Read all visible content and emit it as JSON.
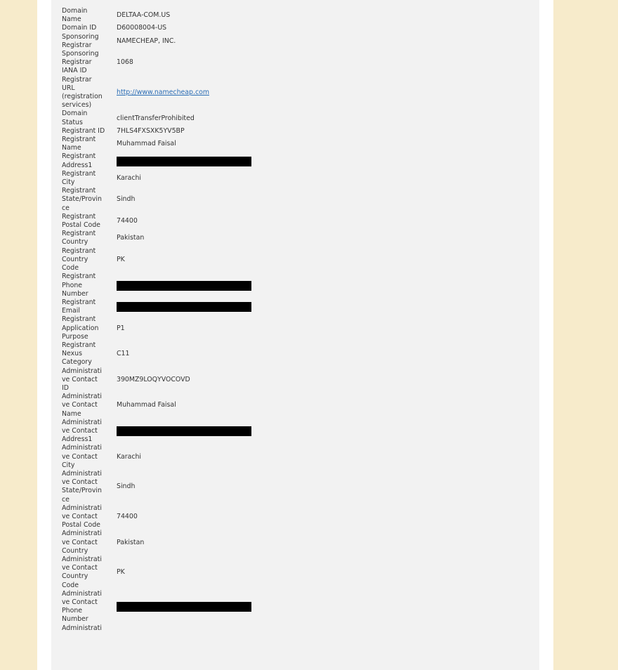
{
  "rows": [
    {
      "label": [
        "Domain",
        "Name"
      ],
      "value": "DELTAA-COM.US"
    },
    {
      "label": [
        "Domain ID"
      ],
      "value": "D60008004-US"
    },
    {
      "label": [
        "Sponsoring",
        "Registrar"
      ],
      "value": "NAMECHEAP, INC."
    },
    {
      "label": [
        "Sponsoring",
        "Registrar",
        "IANA ID"
      ],
      "value": "1068"
    },
    {
      "label": [
        "Registrar",
        "URL",
        "(registration",
        "services)"
      ],
      "value": "http://www.namecheap.com",
      "link": true
    },
    {
      "label": [
        "Domain",
        "Status"
      ],
      "value": "clientTransferProhibited"
    },
    {
      "label": [
        "Registrant ID"
      ],
      "value": "7HLS4FXSXK5YV5BP"
    },
    {
      "label": [
        "Registrant",
        "Name"
      ],
      "value": "Muhammad Faisal"
    },
    {
      "label": [
        "Registrant",
        "Address1"
      ],
      "value": "",
      "redacted": true
    },
    {
      "label": [
        "Registrant",
        "City"
      ],
      "value": "Karachi"
    },
    {
      "label": [
        "Registrant",
        "State/Provin",
        "ce"
      ],
      "value": "Sindh"
    },
    {
      "label": [
        "Registrant",
        "Postal Code"
      ],
      "value": "74400"
    },
    {
      "label": [
        "Registrant",
        "Country"
      ],
      "value": "Pakistan"
    },
    {
      "label": [
        "Registrant",
        "Country",
        "Code"
      ],
      "value": "PK"
    },
    {
      "label": [
        "Registrant",
        "Phone",
        "Number"
      ],
      "value": "",
      "redacted": true
    },
    {
      "label": [
        "Registrant",
        "Email"
      ],
      "value": "",
      "redacted": true
    },
    {
      "label": [
        "Registrant",
        "Application",
        "Purpose"
      ],
      "value": "P1"
    },
    {
      "label": [
        "Registrant",
        "Nexus",
        "Category"
      ],
      "value": "C11"
    },
    {
      "label": [
        "Administrati",
        "ve Contact",
        "ID"
      ],
      "value": "390MZ9LOQYVOCOVD"
    },
    {
      "label": [
        "Administrati",
        "ve Contact",
        "Name"
      ],
      "value": "Muhammad Faisal"
    },
    {
      "label": [
        "Administrati",
        "ve Contact",
        "Address1"
      ],
      "value": "",
      "redacted": true
    },
    {
      "label": [
        "Administrati",
        "ve Contact",
        "City"
      ],
      "value": "Karachi"
    },
    {
      "label": [
        "Administrati",
        "ve Contact",
        "State/Provin",
        "ce"
      ],
      "value": "Sindh"
    },
    {
      "label": [
        "Administrati",
        "ve Contact",
        "Postal Code"
      ],
      "value": "74400"
    },
    {
      "label": [
        "Administrati",
        "ve Contact",
        "Country"
      ],
      "value": "Pakistan"
    },
    {
      "label": [
        "Administrati",
        "ve Contact",
        "Country",
        "Code"
      ],
      "value": "PK"
    },
    {
      "label": [
        "Administrati",
        "ve Contact",
        "Phone",
        "Number"
      ],
      "value": "",
      "redacted": true
    },
    {
      "label": [
        "Administrati"
      ],
      "value": ""
    }
  ]
}
